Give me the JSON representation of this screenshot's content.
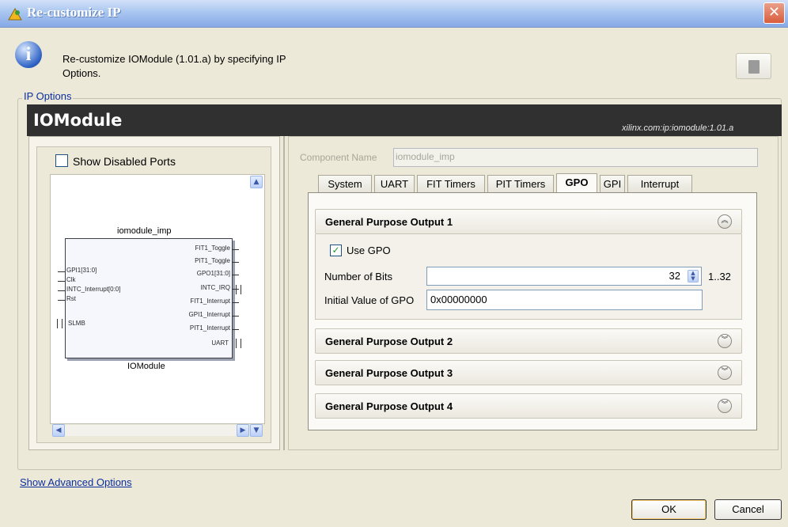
{
  "window": {
    "title": "Re-customize IP",
    "close_glyph": "✕"
  },
  "header": {
    "description": "Re-customize IOModule (1.01.a) by specifying IP Options.",
    "info_icon": "info-icon",
    "doc_icon": "document-icon"
  },
  "ip_options": {
    "legend": "IP Options",
    "module_name": "IOModule",
    "vlnv": "xilinx.com:ip:iomodule:1.01.a"
  },
  "symbol_panel": {
    "show_disabled_label": "Show Disabled Ports",
    "show_disabled_checked": false,
    "instance_name": "iomodule_imp",
    "caption": "IOModule",
    "left_ports": [
      "GPI1[31:0]",
      "Clk",
      "INTC_Interrupt[0:0]",
      "Rst",
      "SLMB"
    ],
    "right_ports": [
      "FIT1_Toggle",
      "PIT1_Toggle",
      "GPO1[31:0]",
      "INTC_IRQ",
      "FIT1_Interrupt",
      "GPI1_Interrupt",
      "PIT1_Interrupt",
      "UART"
    ]
  },
  "config": {
    "component_name_label": "Component Name",
    "component_name_value": "iomodule_imp",
    "tabs": [
      "System",
      "UART",
      "FIT Timers",
      "PIT Timers",
      "GPO",
      "GPI",
      "Interrupt"
    ],
    "active_tab": "GPO",
    "sections": [
      {
        "title": "General Purpose Output 1",
        "expanded": true
      },
      {
        "title": "General Purpose Output 2",
        "expanded": false
      },
      {
        "title": "General Purpose Output 3",
        "expanded": false
      },
      {
        "title": "General Purpose Output 4",
        "expanded": false
      }
    ],
    "gpo1": {
      "use_gpo_label": "Use GPO",
      "use_gpo_checked": true,
      "num_bits_label": "Number of Bits",
      "num_bits_value": "32",
      "num_bits_range": "1..32",
      "init_label": "Initial Value of GPO",
      "init_value": "0x00000000"
    }
  },
  "footer": {
    "advanced_link": "Show Advanced Options",
    "ok": "OK",
    "cancel": "Cancel"
  }
}
